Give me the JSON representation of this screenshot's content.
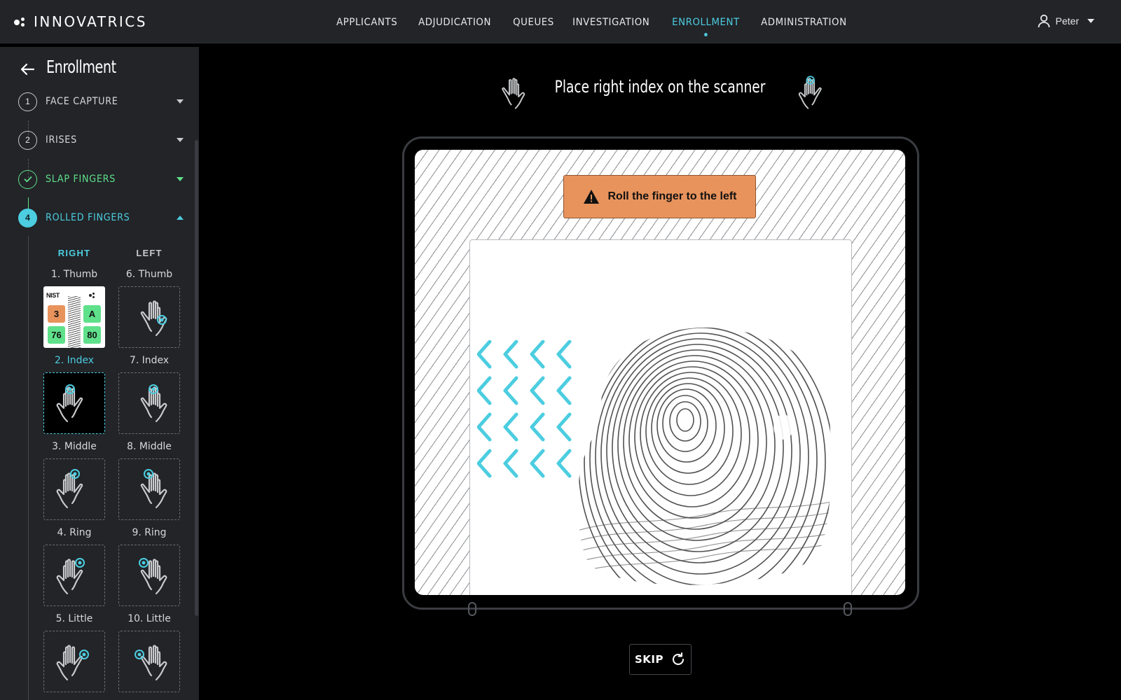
{
  "app": {
    "logo_text": "INNOVATRICS"
  },
  "nav": {
    "items": [
      {
        "label": "APPLICANTS",
        "active": false
      },
      {
        "label": "ADJUDICATION",
        "active": false
      },
      {
        "label": "QUEUES",
        "active": false
      },
      {
        "label": "INVESTIGATION",
        "active": false
      },
      {
        "label": "ENROLLMENT",
        "active": true
      },
      {
        "label": "ADMINISTRATION",
        "active": false
      }
    ]
  },
  "user": {
    "name": "Peter",
    "icon": "user-icon"
  },
  "sidebar": {
    "title": "Enrollment",
    "steps": [
      {
        "number": "1",
        "label": "FACE CAPTURE",
        "state": "pending"
      },
      {
        "number": "2",
        "label": "IRISES",
        "state": "pending"
      },
      {
        "number": "",
        "label": "SLAP FINGERS",
        "state": "done",
        "icon": "check-icon"
      },
      {
        "number": "4",
        "label": "ROLLED FINGERS",
        "state": "active"
      }
    ],
    "columns": {
      "right": "RIGHT",
      "left": "LEFT"
    },
    "fingers": [
      {
        "right": "1. Thumb",
        "left": "6. Thumb"
      },
      {
        "right": "2. Index",
        "left": "7. Index"
      },
      {
        "right": "3. Middle",
        "left": "8. Middle"
      },
      {
        "right": "4. Ring",
        "left": "9. Ring"
      },
      {
        "right": "5. Little",
        "left": "10. Little"
      }
    ],
    "thumb_result": {
      "nist_label": "NIST",
      "nfiq": "3",
      "grade": "A",
      "score_left": "76",
      "score_right": "80"
    }
  },
  "main": {
    "instruction": "Place right index on the scanner",
    "warning": "Roll the finger to the left",
    "skip_label": "SKIP"
  },
  "colors": {
    "accent": "#4ccde0",
    "success": "#5fe08a",
    "warning": "#e8935c",
    "panel": "#222428",
    "background": "#000000"
  }
}
